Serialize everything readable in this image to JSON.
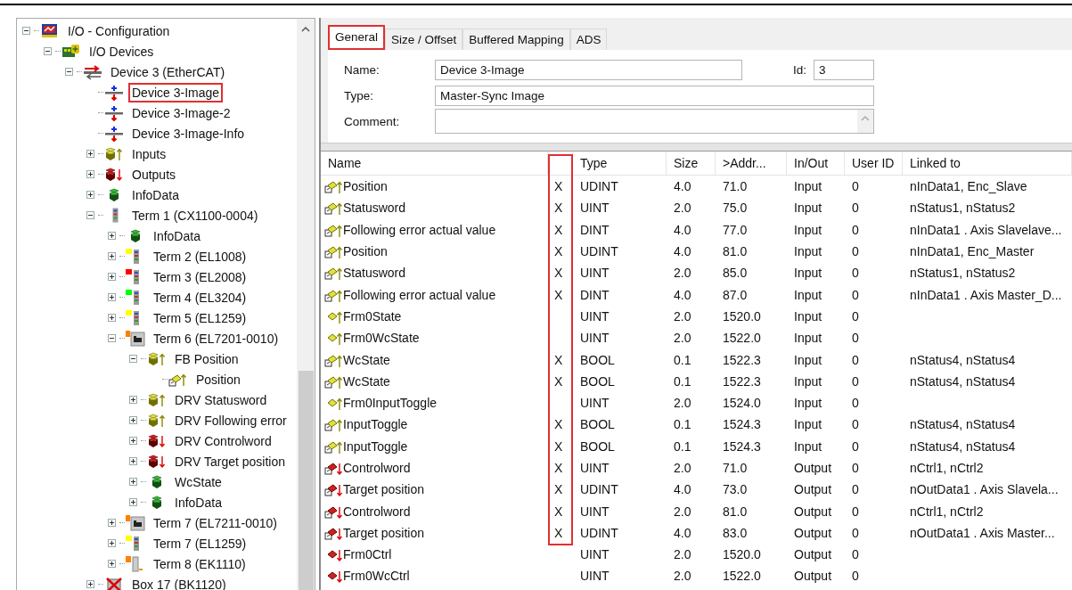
{
  "tree": [
    {
      "label": "I/O - Configuration",
      "kind": "config",
      "expanded": true,
      "children": [
        {
          "label": "I/O Devices",
          "kind": "devices",
          "expanded": true,
          "children": [
            {
              "label": "Device 3 (EtherCAT)",
              "kind": "ethercat",
              "expanded": true,
              "children": [
                {
                  "label": "Device 3-Image",
                  "kind": "image",
                  "highlighted": true
                },
                {
                  "label": "Device 3-Image-2",
                  "kind": "image",
                  "highlighted": false
                },
                {
                  "label": "Device 3-Image-Info",
                  "kind": "image",
                  "highlighted": false
                },
                {
                  "label": "Inputs",
                  "kind": "inputs",
                  "expanded": false
                },
                {
                  "label": "Outputs",
                  "kind": "outputs",
                  "expanded": false
                },
                {
                  "label": "InfoData",
                  "kind": "info",
                  "expanded": false
                },
                {
                  "label": "Term 1 (CX1100-0004)",
                  "kind": "term",
                  "expanded": true,
                  "children": [
                    {
                      "label": "InfoData",
                      "kind": "info",
                      "expanded": false
                    },
                    {
                      "label": "Term 2 (EL1008)",
                      "kind": "term",
                      "color": "#ffff00",
                      "expanded": false
                    },
                    {
                      "label": "Term 3 (EL2008)",
                      "kind": "term",
                      "color": "#ff0000",
                      "expanded": false
                    },
                    {
                      "label": "Term 4 (EL3204)",
                      "kind": "term",
                      "color": "#00ff00",
                      "expanded": false
                    },
                    {
                      "label": "Term 5 (EL1259)",
                      "kind": "term",
                      "color": "#ffff00",
                      "expanded": false
                    },
                    {
                      "label": "Term 6 (EL7201-0010)",
                      "kind": "drive",
                      "color": "#ff8000",
                      "expanded": true,
                      "children": [
                        {
                          "label": "FB Position",
                          "kind": "inputs",
                          "expanded": true,
                          "children": [
                            {
                              "label": "Position",
                              "kind": "linked-input"
                            }
                          ]
                        },
                        {
                          "label": "DRV Statusword",
                          "kind": "inputs",
                          "expanded": false
                        },
                        {
                          "label": "DRV Following error",
                          "kind": "inputs",
                          "expanded": false
                        },
                        {
                          "label": "DRV Controlword",
                          "kind": "outputs",
                          "expanded": false
                        },
                        {
                          "label": "DRV Target position",
                          "kind": "outputs",
                          "expanded": false
                        },
                        {
                          "label": "WcState",
                          "kind": "info",
                          "expanded": false
                        },
                        {
                          "label": "InfoData",
                          "kind": "info",
                          "expanded": false
                        }
                      ]
                    },
                    {
                      "label": "Term 7 (EL7211-0010)",
                      "kind": "drive",
                      "color": "#ff8000",
                      "expanded": false
                    },
                    {
                      "label": "Term 7 (EL1259)",
                      "kind": "term",
                      "color": "#ffff00",
                      "expanded": false
                    },
                    {
                      "label": "Term 8 (EK1110)",
                      "kind": "coupler",
                      "color": "#ff8000",
                      "expanded": false
                    }
                  ]
                },
                {
                  "label": "Box 17 (BK1120)",
                  "kind": "box",
                  "expanded": false
                }
              ]
            }
          ]
        }
      ]
    }
  ],
  "tabs": [
    {
      "label": "General",
      "selected": true,
      "highlighted": true
    },
    {
      "label": "Size / Offset",
      "selected": false,
      "highlighted": false
    },
    {
      "label": "Buffered Mapping",
      "selected": false,
      "highlighted": false
    },
    {
      "label": "ADS",
      "selected": false,
      "highlighted": false
    }
  ],
  "form": {
    "name_label": "Name:",
    "name_value": "Device 3-Image",
    "id_label": "Id:",
    "id_value": "3",
    "type_label": "Type:",
    "type_value": "Master-Sync Image",
    "comment_label": "Comment:"
  },
  "table": {
    "columns": [
      {
        "label": "Name"
      },
      {
        "highlighted": true
      },
      {
        "label": "Type"
      },
      {
        "label": "Size"
      },
      {
        "label": ">Addr..."
      },
      {
        "label": "In/Out"
      },
      {
        "label": "User ID"
      },
      {
        "label": "Linked to"
      }
    ],
    "rows": [
      {
        "kind": "linked-input",
        "cells": [
          "Position",
          "X",
          "UDINT",
          "4.0",
          "71.0",
          "Input",
          "0",
          "nInData1, Enc_Slave"
        ]
      },
      {
        "kind": "linked-input",
        "cells": [
          "Statusword",
          "X",
          "UINT",
          "2.0",
          "75.0",
          "Input",
          "0",
          "nStatus1, nStatus2"
        ]
      },
      {
        "kind": "linked-input",
        "cells": [
          "Following error actual value",
          "X",
          "DINT",
          "4.0",
          "77.0",
          "Input",
          "0",
          "nInData1 . Axis Slavelave..."
        ]
      },
      {
        "kind": "linked-input",
        "cells": [
          "Position",
          "X",
          "UDINT",
          "4.0",
          "81.0",
          "Input",
          "0",
          "nInData1, Enc_Master"
        ]
      },
      {
        "kind": "linked-input",
        "cells": [
          "Statusword",
          "X",
          "UINT",
          "2.0",
          "85.0",
          "Input",
          "0",
          "nStatus1, nStatus2"
        ]
      },
      {
        "kind": "linked-input",
        "cells": [
          "Following error actual value",
          "X",
          "DINT",
          "4.0",
          "87.0",
          "Input",
          "0",
          "nInData1 . Axis Master_D..."
        ]
      },
      {
        "kind": "input",
        "cells": [
          "Frm0State",
          null,
          "UINT",
          "2.0",
          "1520.0",
          "Input",
          "0",
          null
        ]
      },
      {
        "kind": "input",
        "cells": [
          "Frm0WcState",
          null,
          "UINT",
          "2.0",
          "1522.0",
          "Input",
          "0",
          null
        ]
      },
      {
        "kind": "linked-input",
        "cells": [
          "WcState",
          "X",
          "BOOL",
          "0.1",
          "1522.3",
          "Input",
          "0",
          "nStatus4, nStatus4"
        ]
      },
      {
        "kind": "linked-input",
        "cells": [
          "WcState",
          "X",
          "BOOL",
          "0.1",
          "1522.3",
          "Input",
          "0",
          "nStatus4, nStatus4"
        ]
      },
      {
        "kind": "input",
        "cells": [
          "Frm0InputToggle",
          null,
          "UINT",
          "2.0",
          "1524.0",
          "Input",
          "0",
          null
        ]
      },
      {
        "kind": "linked-input",
        "cells": [
          "InputToggle",
          "X",
          "BOOL",
          "0.1",
          "1524.3",
          "Input",
          "0",
          "nStatus4, nStatus4"
        ]
      },
      {
        "kind": "linked-input",
        "cells": [
          "InputToggle",
          "X",
          "BOOL",
          "0.1",
          "1524.3",
          "Input",
          "0",
          "nStatus4, nStatus4"
        ]
      },
      {
        "kind": "linked-output",
        "cells": [
          "Controlword",
          "X",
          "UINT",
          "2.0",
          "71.0",
          "Output",
          "0",
          "nCtrl1, nCtrl2"
        ]
      },
      {
        "kind": "linked-output",
        "cells": [
          "Target position",
          "X",
          "UDINT",
          "4.0",
          "73.0",
          "Output",
          "0",
          "nOutData1 . Axis Slavela..."
        ]
      },
      {
        "kind": "linked-output",
        "cells": [
          "Controlword",
          "X",
          "UINT",
          "2.0",
          "81.0",
          "Output",
          "0",
          "nCtrl1, nCtrl2"
        ]
      },
      {
        "kind": "linked-output",
        "cells": [
          "Target position",
          "X",
          "UDINT",
          "4.0",
          "83.0",
          "Output",
          "0",
          "nOutData1 . Axis Master..."
        ]
      },
      {
        "kind": "output",
        "cells": [
          "Frm0Ctrl",
          null,
          "UINT",
          "2.0",
          "1520.0",
          "Output",
          "0",
          null
        ]
      },
      {
        "kind": "output",
        "cells": [
          "Frm0WcCtrl",
          null,
          "UINT",
          "2.0",
          "1522.0",
          "Output",
          "0",
          null
        ]
      }
    ]
  }
}
